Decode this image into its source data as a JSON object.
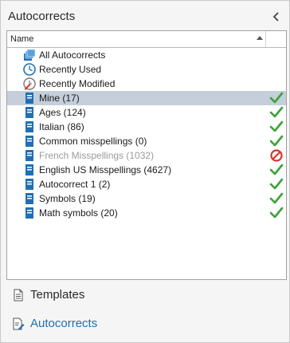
{
  "panel": {
    "title": "Autocorrects",
    "collapse_icon": "chevron-left-icon"
  },
  "list": {
    "columns": {
      "name": "Name"
    },
    "sort": "ascending",
    "items": [
      {
        "label": "All Autocorrects",
        "icon": "books-icon",
        "status": ""
      },
      {
        "label": "Recently Used",
        "icon": "clock-icon",
        "status": ""
      },
      {
        "label": "Recently Modified",
        "icon": "clock-edit-icon",
        "status": ""
      },
      {
        "label": "Mine (17)",
        "icon": "book-icon",
        "status": "enabled",
        "selected": true
      },
      {
        "label": "Ages (124)",
        "icon": "book-icon",
        "status": "enabled"
      },
      {
        "label": "Italian (86)",
        "icon": "book-icon",
        "status": "enabled"
      },
      {
        "label": "Common misspellings (0)",
        "icon": "book-icon",
        "status": "enabled"
      },
      {
        "label": "French Misspellings (1032)",
        "icon": "book-icon",
        "status": "disabled"
      },
      {
        "label": "English US Misspellings (4627)",
        "icon": "book-icon",
        "status": "enabled"
      },
      {
        "label": "Autocorrect 1 (2)",
        "icon": "book-icon",
        "status": "enabled"
      },
      {
        "label": "Symbols (19)",
        "icon": "book-icon",
        "status": "enabled"
      },
      {
        "label": "Math symbols (20)",
        "icon": "book-icon",
        "status": "enabled"
      }
    ]
  },
  "nav": {
    "templates": {
      "label": "Templates",
      "icon": "document-icon"
    },
    "autocorrects": {
      "label": "Autocorrects",
      "icon": "document-edit-icon"
    }
  },
  "colors": {
    "selection": "#c5cfdb",
    "check_green": "#3aa335",
    "prohibit_red": "#d9342b",
    "book_blue": "#1f6fb5",
    "link_blue": "#1f6fb5"
  }
}
